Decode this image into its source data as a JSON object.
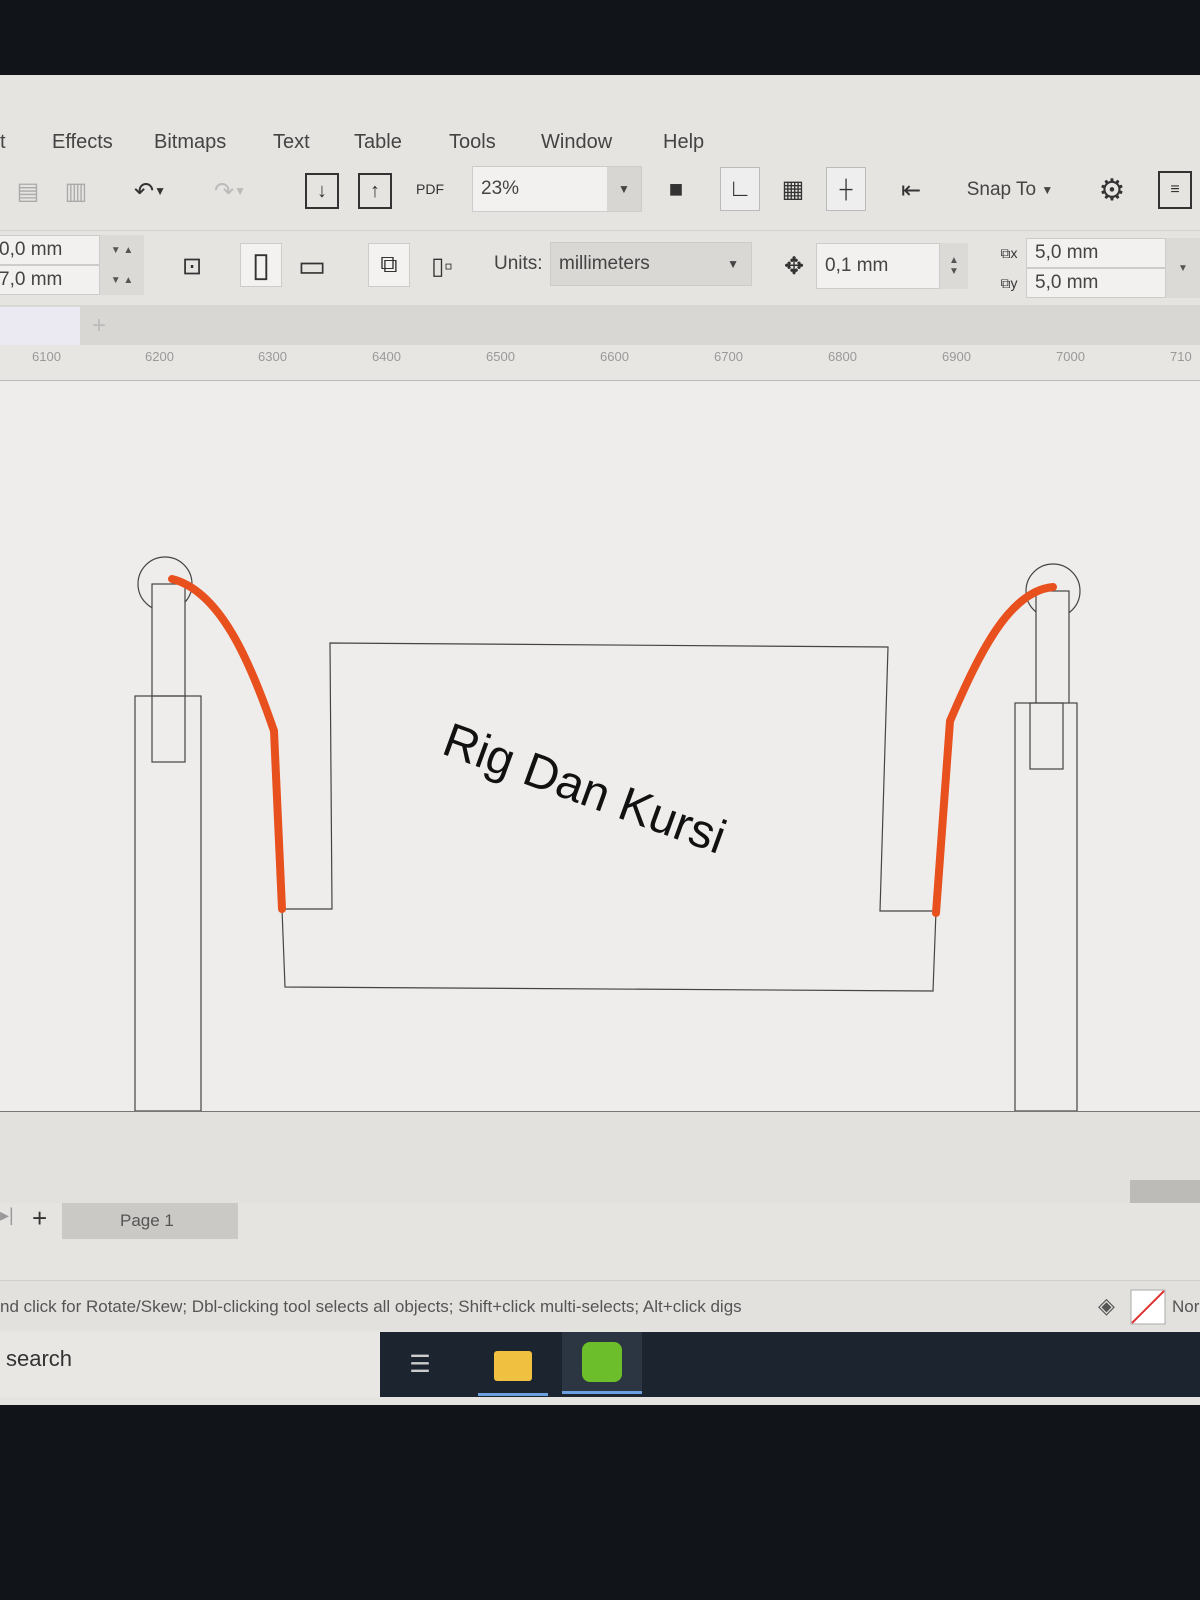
{
  "menu": [
    "t",
    "Effects",
    "Bitmaps",
    "Text",
    "Table",
    "Tools",
    "Window",
    "Help"
  ],
  "toolbar": {
    "pdf_label": "PDF",
    "zoom": "23%",
    "snap_to": "Snap To"
  },
  "property_bar": {
    "x_value": "0,0 mm",
    "y_value": "7,0 mm",
    "units_label": "Units:",
    "units_value": "millimeters",
    "nudge": "0,1 mm",
    "dup_x": "5,0 mm",
    "dup_y": "5,0 mm"
  },
  "ruler": [
    "6100",
    "6200",
    "6300",
    "6400",
    "6500",
    "6600",
    "6700",
    "6800",
    "6900",
    "7000",
    "710"
  ],
  "canvas": {
    "text": "Rig Dan Kursi",
    "accent": "#e8501e"
  },
  "pages": {
    "add": "+",
    "tab": "Page 1"
  },
  "status": {
    "hint": "nd click for Rotate/Skew; Dbl-clicking tool selects all objects; Shift+click multi-selects; Alt+click digs",
    "fill": "Nor"
  },
  "taskbar": {
    "search": "search"
  }
}
